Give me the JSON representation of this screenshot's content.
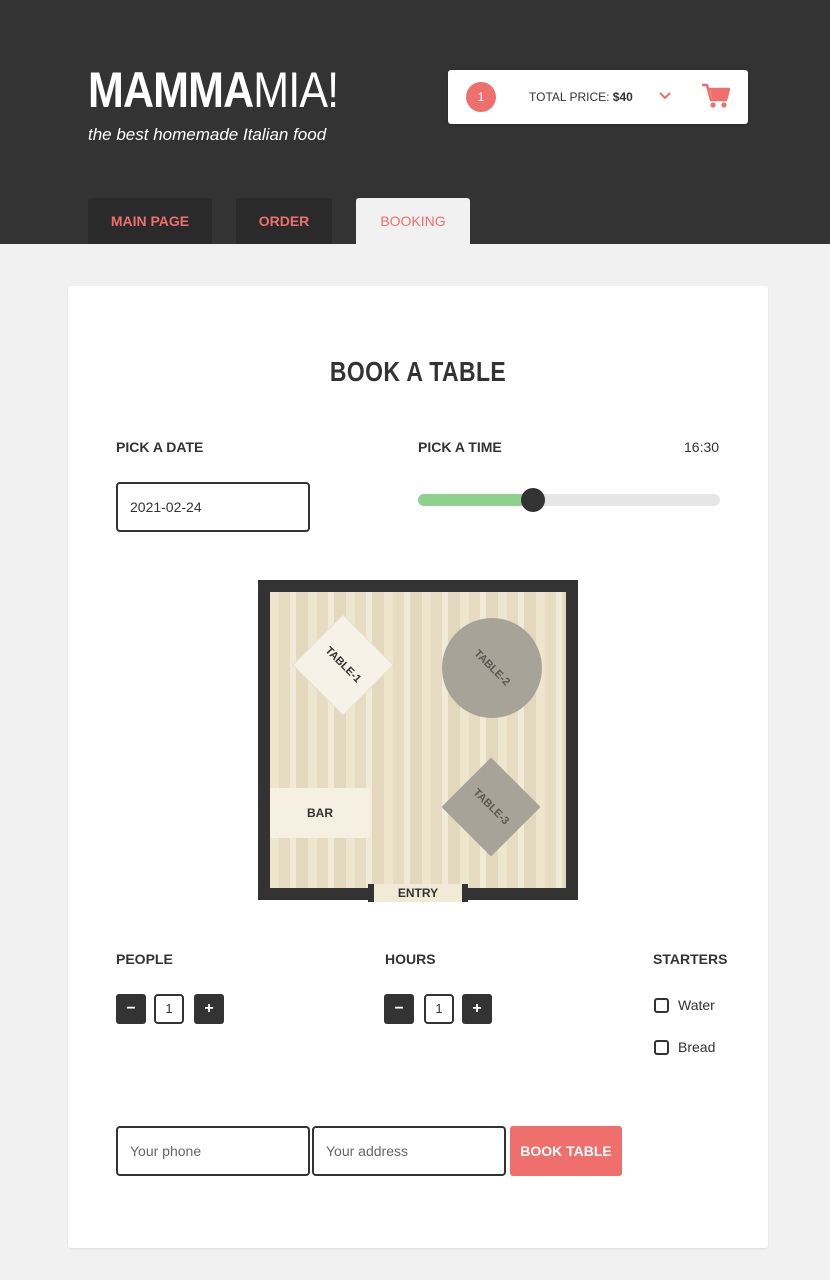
{
  "brand": {
    "logo_bold": "MAMMA",
    "logo_thin": "MIA!",
    "tagline": "the best homemade Italian food"
  },
  "cart": {
    "count": "1",
    "total_label": "TOTAL PRICE: ",
    "total_amount": "$40",
    "accent": "#ef6f6c"
  },
  "nav": {
    "tabs": [
      {
        "label": "MAIN PAGE"
      },
      {
        "label": "ORDER"
      },
      {
        "label": "BOOKING",
        "active": true
      }
    ]
  },
  "booking": {
    "title": "BOOK A TABLE",
    "date_label": "PICK A DATE",
    "date_value": "2021-02-24",
    "time_label": "PICK A TIME",
    "time_value": "16:30",
    "slider_fraction": 0.38,
    "floor": {
      "tables": [
        {
          "label": "TABLE-1",
          "status": "free"
        },
        {
          "label": "TABLE-2",
          "status": "booked"
        },
        {
          "label": "TABLE-3",
          "status": "booked"
        }
      ],
      "bar_label": "BAR",
      "entry_label": "ENTRY"
    },
    "people": {
      "label": "PEOPLE",
      "value": "1"
    },
    "hours": {
      "label": "HOURS",
      "value": "1"
    },
    "starters": {
      "label": "STARTERS",
      "options": [
        {
          "label": "Water",
          "checked": false
        },
        {
          "label": "Bread",
          "checked": false
        }
      ]
    },
    "phone_placeholder": "Your phone",
    "address_placeholder": "Your address",
    "submit_label": "BOOK TABLE",
    "minus": "−",
    "plus": "+"
  }
}
